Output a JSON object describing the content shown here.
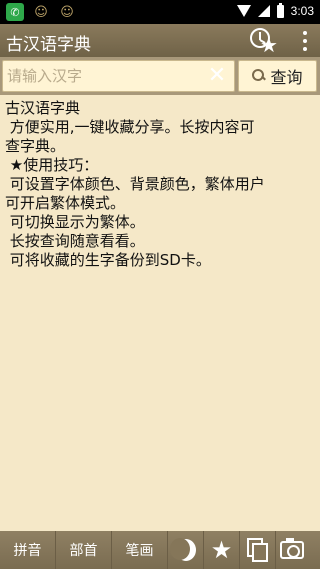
{
  "status_bar": {
    "time": "3:03"
  },
  "app_bar": {
    "title": "古汉语字典"
  },
  "search": {
    "placeholder": "请输入汉字",
    "value": "",
    "clear_symbol": "✕",
    "query_label": "查询"
  },
  "content": {
    "lines": [
      "古汉语字典",
      " 方便实用,一键收藏分享。长按内容可",
      "查字典。",
      "",
      " ★使用技巧：",
      " 可设置字体颜色、背景颜色，繁体用户",
      "可开启繁体模式。",
      " 可切换显示为繁体。",
      " 长按查询随意看看。",
      " 可将收藏的生字备份到SD卡。"
    ]
  },
  "bottom_bar": {
    "pinyin_label": "拼音",
    "radical_label": "部首",
    "strokes_label": "笔画",
    "star_symbol": "★"
  },
  "colors": {
    "background": "#f5e8c8",
    "app_bar": "#7d6f52",
    "status_icon": "#2ea84a"
  },
  "icons": [
    "phone-icon",
    "emoji-icon",
    "emoji-icon",
    "wifi-icon",
    "signal-icon",
    "battery-icon",
    "history-star-icon",
    "overflow-menu-icon",
    "clear-icon",
    "search-icon",
    "moon-icon",
    "star-icon",
    "documents-icon",
    "camera-icon"
  ]
}
